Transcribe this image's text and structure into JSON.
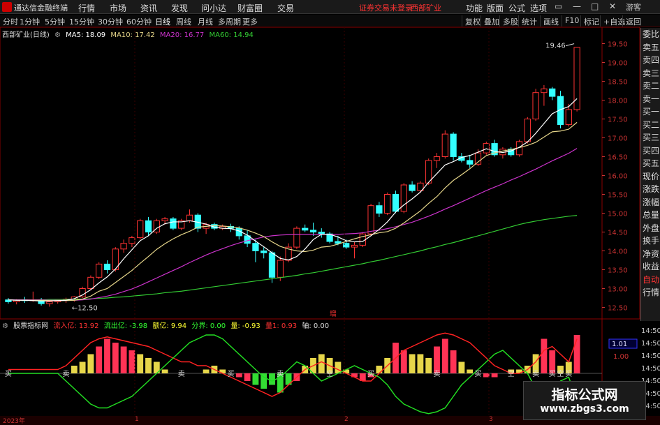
{
  "titlebar": {
    "app_name": "通达信金融终端",
    "menus": [
      "行情",
      "市场",
      "资讯",
      "发现",
      "问小达",
      "财富圈",
      "交易"
    ],
    "login_status": "证券交易未登录",
    "stock_name": "西部矿业",
    "right_menus": [
      "功能",
      "版面",
      "公式",
      "选项"
    ]
  },
  "tabs": [
    "分时",
    "1分钟",
    "5分钟",
    "15分钟",
    "30分钟",
    "60分钟",
    "日线",
    "周线",
    "月线",
    "多周期",
    "更多"
  ],
  "active_tab": "日线",
  "right_buttons": [
    "复权",
    "叠加",
    "多股",
    "统计",
    "画线",
    "F10",
    "标记",
    "+自选",
    "返回"
  ],
  "info": {
    "stock": "西部矿业(日线)",
    "ma5": "MA5: 18.09",
    "ma10": "MA10: 17.42",
    "ma20": "MA20: 16.77",
    "ma60": "MA60: 14.94"
  },
  "price_axis": [
    "19.50",
    "19.00",
    "18.50",
    "18.00",
    "17.50",
    "17.00",
    "16.50",
    "16.00",
    "15.50",
    "15.00",
    "14.50",
    "14.00",
    "13.50",
    "13.00",
    "12.50"
  ],
  "annotations": {
    "high": "19.46",
    "low": "12.50",
    "mid_marker": "增"
  },
  "right_panel": [
    "委比",
    "卖五",
    "卖四",
    "卖三",
    "卖二",
    "卖一",
    "买一",
    "买二",
    "买三",
    "买四",
    "买五",
    "现价",
    "涨跌",
    "涨幅",
    "总量",
    "外盘",
    "换手",
    "净资",
    "收益",
    "自动",
    "行情"
  ],
  "right_panel_small": [
    "14:50",
    "14:50",
    "14:50",
    "14:50",
    "14:50",
    "14:50",
    "14:50",
    "14:50"
  ],
  "indicator": {
    "name": "股票指标网",
    "inflow": "流入亿: 13.92",
    "outflow": "流出亿: -3.98",
    "net": "额亿: 9.94",
    "divide": "分界: 0.00",
    "vol": "量: -0.93",
    "vol2": "量1: 0.93",
    "axis": "轴: 0.00",
    "axis_val": "1.01",
    "axis_val2": "1.00",
    "bar_labels": [
      "买",
      "卖",
      "卖",
      "买",
      "卖",
      "空",
      "买",
      "卖",
      "买",
      "空",
      "卖",
      "买",
      "空",
      "买"
    ]
  },
  "bottom_axis": [
    "2023年",
    "1",
    "2",
    "3"
  ],
  "watermark": {
    "line1": "指标公式网",
    "line2": "www.zbgs3.com"
  },
  "colors": {
    "up": "#ff3333",
    "down": "#33ffff",
    "ma5": "#ffffff",
    "ma10": "#e6d68a",
    "ma20": "#cc33cc",
    "ma60": "#33cc33"
  },
  "chart_data": {
    "type": "candlestick",
    "candles": [
      [
        12.7,
        12.75,
        12.6,
        12.65
      ],
      [
        12.65,
        12.72,
        12.58,
        12.7
      ],
      [
        12.7,
        12.78,
        12.62,
        12.68
      ],
      [
        12.68,
        12.92,
        12.65,
        12.7
      ],
      [
        12.7,
        12.75,
        12.55,
        12.6
      ],
      [
        12.6,
        12.68,
        12.52,
        12.65
      ],
      [
        12.65,
        12.72,
        12.6,
        12.7
      ],
      [
        12.7,
        12.76,
        12.62,
        12.72
      ],
      [
        12.72,
        12.8,
        12.65,
        12.78
      ],
      [
        12.78,
        13.05,
        12.75,
        13.0
      ],
      [
        13.0,
        13.35,
        12.95,
        13.3
      ],
      [
        13.3,
        13.7,
        13.25,
        13.65
      ],
      [
        13.65,
        13.75,
        13.4,
        13.5
      ],
      [
        13.5,
        14.1,
        13.45,
        14.05
      ],
      [
        14.05,
        14.3,
        13.95,
        14.2
      ],
      [
        14.2,
        14.4,
        14.1,
        14.35
      ],
      [
        14.35,
        14.85,
        14.3,
        14.8
      ],
      [
        14.8,
        14.9,
        14.4,
        14.5
      ],
      [
        14.5,
        14.85,
        14.45,
        14.8
      ],
      [
        14.8,
        14.9,
        14.7,
        14.85
      ],
      [
        14.85,
        14.9,
        14.55,
        14.6
      ],
      [
        14.6,
        14.85,
        14.55,
        14.8
      ],
      [
        14.8,
        15.1,
        14.75,
        14.95
      ],
      [
        14.95,
        15.0,
        14.5,
        14.6
      ],
      [
        14.6,
        14.75,
        14.45,
        14.7
      ],
      [
        14.7,
        14.75,
        14.55,
        14.6
      ],
      [
        14.6,
        14.7,
        14.55,
        14.65
      ],
      [
        14.65,
        14.72,
        14.5,
        14.6
      ],
      [
        14.6,
        14.65,
        14.3,
        14.4
      ],
      [
        14.4,
        14.55,
        14.1,
        14.2
      ],
      [
        14.2,
        14.3,
        13.7,
        14.0
      ],
      [
        14.0,
        14.1,
        13.8,
        13.95
      ],
      [
        13.95,
        14.0,
        13.15,
        13.3
      ],
      [
        13.3,
        13.85,
        13.2,
        13.75
      ],
      [
        13.75,
        14.2,
        13.7,
        14.1
      ],
      [
        14.1,
        14.65,
        14.05,
        14.6
      ],
      [
        14.6,
        14.7,
        14.5,
        14.55
      ],
      [
        14.55,
        14.75,
        14.4,
        14.5
      ],
      [
        14.5,
        14.6,
        14.35,
        14.45
      ],
      [
        14.45,
        14.5,
        14.2,
        14.25
      ],
      [
        14.25,
        14.4,
        14.15,
        14.2
      ],
      [
        14.2,
        14.3,
        14.05,
        14.1
      ],
      [
        14.1,
        14.25,
        13.8,
        14.15
      ],
      [
        14.15,
        14.5,
        14.1,
        14.45
      ],
      [
        14.45,
        15.25,
        14.4,
        15.2
      ],
      [
        15.2,
        15.3,
        14.9,
        15.0
      ],
      [
        15.0,
        15.55,
        14.95,
        15.5
      ],
      [
        15.5,
        15.6,
        15.0,
        15.05
      ],
      [
        15.05,
        15.8,
        15.0,
        15.75
      ],
      [
        15.75,
        15.85,
        15.55,
        15.6
      ],
      [
        15.6,
        15.85,
        15.55,
        15.8
      ],
      [
        15.8,
        16.45,
        15.75,
        16.4
      ],
      [
        16.4,
        16.6,
        16.2,
        16.5
      ],
      [
        16.5,
        17.2,
        16.45,
        17.1
      ],
      [
        17.1,
        17.15,
        16.4,
        16.5
      ],
      [
        16.5,
        16.6,
        16.35,
        16.4
      ],
      [
        16.4,
        16.55,
        16.2,
        16.3
      ],
      [
        16.3,
        16.7,
        16.25,
        16.6
      ],
      [
        16.6,
        16.9,
        16.55,
        16.85
      ],
      [
        16.85,
        16.95,
        16.5,
        16.55
      ],
      [
        16.55,
        16.75,
        16.45,
        16.7
      ],
      [
        16.7,
        16.75,
        16.5,
        16.55
      ],
      [
        16.55,
        16.95,
        16.5,
        16.9
      ],
      [
        16.9,
        17.55,
        16.85,
        17.5
      ],
      [
        17.5,
        18.3,
        17.45,
        18.2
      ],
      [
        18.2,
        18.4,
        17.85,
        18.3
      ],
      [
        18.3,
        18.35,
        18.0,
        18.1
      ],
      [
        18.1,
        18.25,
        17.25,
        17.35
      ],
      [
        17.35,
        17.9,
        17.3,
        17.75
      ],
      [
        17.75,
        19.4,
        17.7,
        19.4
      ]
    ],
    "ma5": [
      12.7,
      12.69,
      12.69,
      12.68,
      12.67,
      12.67,
      12.68,
      12.69,
      12.73,
      12.83,
      12.97,
      13.15,
      13.31,
      13.52,
      13.79,
      14.03,
      14.27,
      14.4,
      14.6,
      14.72,
      14.77,
      14.77,
      14.8,
      14.76,
      14.71,
      14.63,
      14.6,
      14.59,
      14.53,
      14.42,
      14.26,
      14.11,
      13.95,
      13.8,
      13.76,
      13.85,
      14.05,
      14.3,
      14.44,
      14.44,
      14.37,
      14.27,
      14.24,
      14.25,
      14.4,
      14.57,
      14.77,
      15.03,
      15.22,
      15.38,
      15.56,
      15.82,
      16.05,
      16.28,
      16.37,
      16.48,
      16.53,
      16.62,
      16.71,
      16.64,
      16.61,
      16.65,
      16.75,
      16.89,
      17.12,
      17.38,
      17.64,
      17.75,
      17.83,
      18.04
    ],
    "ma10": [
      12.7,
      12.69,
      12.69,
      12.69,
      12.69,
      12.68,
      12.68,
      12.68,
      12.69,
      12.72,
      12.8,
      12.93,
      13.0,
      13.16,
      13.32,
      13.48,
      13.67,
      13.85,
      14.04,
      14.19,
      14.32,
      14.43,
      14.52,
      14.63,
      14.65,
      14.67,
      14.66,
      14.64,
      14.61,
      14.55,
      14.47,
      14.38,
      14.24,
      14.12,
      14.05,
      14.0,
      13.98,
      14.02,
      14.1,
      14.12,
      14.18,
      14.25,
      14.32,
      14.38,
      14.43,
      14.48,
      14.51,
      14.6,
      14.74,
      14.9,
      15.06,
      15.26,
      15.44,
      15.67,
      15.87,
      16.02,
      16.18,
      16.36,
      16.53,
      16.6,
      16.65,
      16.69,
      16.74,
      16.8,
      16.88,
      17.02,
      17.16,
      17.18,
      17.23,
      17.41
    ],
    "ma20": [
      12.7,
      12.7,
      12.7,
      12.7,
      12.7,
      12.69,
      12.69,
      12.69,
      12.69,
      12.7,
      12.72,
      12.76,
      12.8,
      12.85,
      12.92,
      12.99,
      13.08,
      13.18,
      13.28,
      13.38,
      13.48,
      13.58,
      13.69,
      13.79,
      13.89,
      13.98,
      14.06,
      14.14,
      14.21,
      14.27,
      14.32,
      14.37,
      14.4,
      14.42,
      14.43,
      14.44,
      14.44,
      14.44,
      14.44,
      14.44,
      14.44,
      14.45,
      14.46,
      14.48,
      14.52,
      14.55,
      14.59,
      14.64,
      14.7,
      14.76,
      14.84,
      14.92,
      15.01,
      15.11,
      15.2,
      15.3,
      15.4,
      15.5,
      15.6,
      15.69,
      15.78,
      15.88,
      15.97,
      16.07,
      16.17,
      16.28,
      16.39,
      16.49,
      16.59,
      16.72
    ],
    "ma60": [
      12.7,
      12.7,
      12.7,
      12.7,
      12.7,
      12.71,
      12.71,
      12.71,
      12.72,
      12.72,
      12.73,
      12.74,
      12.75,
      12.77,
      12.78,
      12.8,
      12.82,
      12.84,
      12.86,
      12.89,
      12.91,
      12.93,
      12.96,
      12.99,
      13.02,
      13.05,
      13.08,
      13.11,
      13.14,
      13.17,
      13.2,
      13.23,
      13.26,
      13.29,
      13.32,
      13.35,
      13.39,
      13.42,
      13.46,
      13.5,
      13.54,
      13.58,
      13.62,
      13.66,
      13.71,
      13.75,
      13.8,
      13.85,
      13.9,
      13.95,
      14.0,
      14.06,
      14.11,
      14.17,
      14.22,
      14.28,
      14.34,
      14.4,
      14.46,
      14.52,
      14.58,
      14.64,
      14.7,
      14.75,
      14.79,
      14.83,
      14.86,
      14.89,
      14.92,
      14.94
    ],
    "ylim": [
      12.25,
      19.75
    ],
    "indicator_bars": [
      0,
      0,
      0,
      0,
      0,
      0,
      0,
      0,
      0.2,
      0.3,
      0.5,
      0.7,
      0.9,
      0.8,
      0.7,
      0.6,
      0.5,
      0.4,
      0.3,
      0.1,
      0,
      0,
      0,
      0,
      0.1,
      0.2,
      0.1,
      0,
      -0.1,
      -0.2,
      -0.3,
      -0.4,
      -0.3,
      -0.5,
      -0.3,
      -0.2,
      0.2,
      0.4,
      0.5,
      0.4,
      0.3,
      0.1,
      -0.1,
      -0.2,
      -0.1,
      0.2,
      0.4,
      0.8,
      0.6,
      0.5,
      0.5,
      0.4,
      0.7,
      0.9,
      0.6,
      0.3,
      0.1,
      0,
      -0.1,
      -0.1,
      0,
      0.1,
      0.1,
      0.2,
      0.5,
      0.9,
      0.6,
      0.2,
      0.3,
      1.0
    ],
    "red_line": [
      0.1,
      0.1,
      0.1,
      0.1,
      0.1,
      0.1,
      0.1,
      0.2,
      0.4,
      0.6,
      0.8,
      0.9,
      0.95,
      0.9,
      0.85,
      0.8,
      0.75,
      0.7,
      0.6,
      0.5,
      0.4,
      0.3,
      0.3,
      0.2,
      0.2,
      0.1,
      0,
      -0.1,
      -0.2,
      -0.3,
      -0.4,
      -0.5,
      -0.6,
      -0.5,
      -0.3,
      -0.1,
      0.1,
      0.2,
      0.3,
      0.2,
      0.1,
      0,
      -0.1,
      -0.2,
      -0.2,
      0,
      0.2,
      0.4,
      0.6,
      0.7,
      0.8,
      0.9,
      1.0,
      1.05,
      1.0,
      0.9,
      0.8,
      0.6,
      0.4,
      0.2,
      0.1,
      0,
      0,
      0.1,
      0.3,
      0.6,
      0.7,
      0.5,
      0.3,
      0.9
    ],
    "green_line": [
      0,
      0,
      0,
      0,
      0,
      0,
      0,
      -0.2,
      -0.4,
      -0.6,
      -0.8,
      -0.9,
      -0.9,
      -0.8,
      -0.7,
      -0.6,
      -0.4,
      -0.2,
      0,
      0.2,
      0.4,
      0.6,
      0.8,
      0.9,
      1.0,
      1.0,
      0.9,
      0.7,
      0.5,
      0.3,
      0.1,
      -0.1,
      -0.2,
      -0.1,
      0.1,
      0.3,
      0.2,
      0,
      -0.2,
      -0.1,
      0,
      0.1,
      0.2,
      0.1,
      0,
      -0.1,
      -0.3,
      -0.6,
      -0.8,
      -0.9,
      -1.0,
      -1.05,
      -1.0,
      -0.9,
      -0.6,
      -0.3,
      -0.1,
      0.1,
      0.3,
      0.5,
      0.6,
      0.4,
      0.2,
      0,
      -0.4,
      -0.8,
      -0.6,
      -0.2,
      -0.1,
      -0.7
    ]
  }
}
